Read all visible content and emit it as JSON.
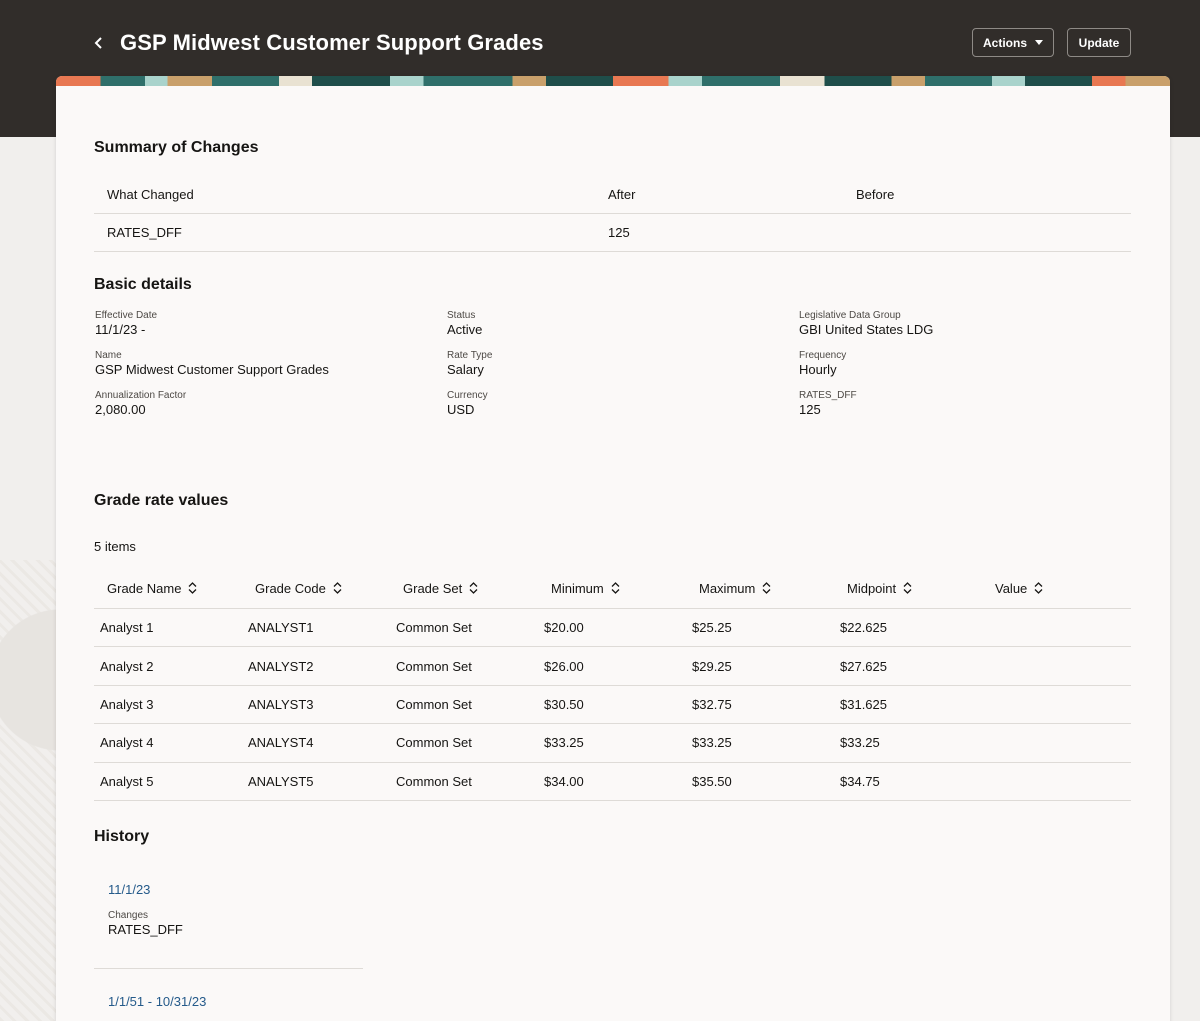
{
  "header": {
    "title": "GSP Midwest Customer Support Grades",
    "actions_label": "Actions",
    "update_label": "Update"
  },
  "summary": {
    "title": "Summary of Changes",
    "columns": [
      "What Changed",
      "After",
      "Before"
    ],
    "rows": [
      {
        "what": "RATES_DFF",
        "after": "125",
        "before": ""
      }
    ]
  },
  "basic": {
    "title": "Basic details",
    "fields": [
      {
        "label": "Effective Date",
        "value": "11/1/23 -"
      },
      {
        "label": "Status",
        "value": "Active"
      },
      {
        "label": "Legislative Data Group",
        "value": "GBI United States LDG"
      },
      {
        "label": "Name",
        "value": "GSP Midwest Customer Support Grades"
      },
      {
        "label": "Rate Type",
        "value": "Salary"
      },
      {
        "label": "Frequency",
        "value": "Hourly"
      },
      {
        "label": "Annualization Factor",
        "value": "2,080.00"
      },
      {
        "label": "Currency",
        "value": "USD"
      },
      {
        "label": "RATES_DFF",
        "value": "125"
      }
    ]
  },
  "grades": {
    "title": "Grade rate values",
    "count": "5 items",
    "columns": [
      "Grade Name",
      "Grade Code",
      "Grade Set",
      "Minimum",
      "Maximum",
      "Midpoint",
      "Value"
    ],
    "rows": [
      [
        "Analyst 1",
        "ANALYST1",
        "Common Set",
        "$20.00",
        "$25.25",
        "$22.625",
        ""
      ],
      [
        "Analyst 2",
        "ANALYST2",
        "Common Set",
        "$26.00",
        "$29.25",
        "$27.625",
        ""
      ],
      [
        "Analyst 3",
        "ANALYST3",
        "Common Set",
        "$30.50",
        "$32.75",
        "$31.625",
        ""
      ],
      [
        "Analyst 4",
        "ANALYST4",
        "Common Set",
        "$33.25",
        "$33.25",
        "$33.25",
        ""
      ],
      [
        "Analyst 5",
        "ANALYST5",
        "Common Set",
        "$34.00",
        "$35.50",
        "$34.75",
        ""
      ]
    ]
  },
  "history": {
    "title": "History",
    "entries": [
      {
        "date": "11/1/23",
        "changes_label": "Changes",
        "changes_value": "RATES_DFF"
      },
      {
        "date": "1/1/51 - 10/31/23"
      }
    ]
  },
  "colors": {
    "header_bg": "#312d2a",
    "card_bg": "#fbf9f8",
    "link": "#245a8a"
  }
}
